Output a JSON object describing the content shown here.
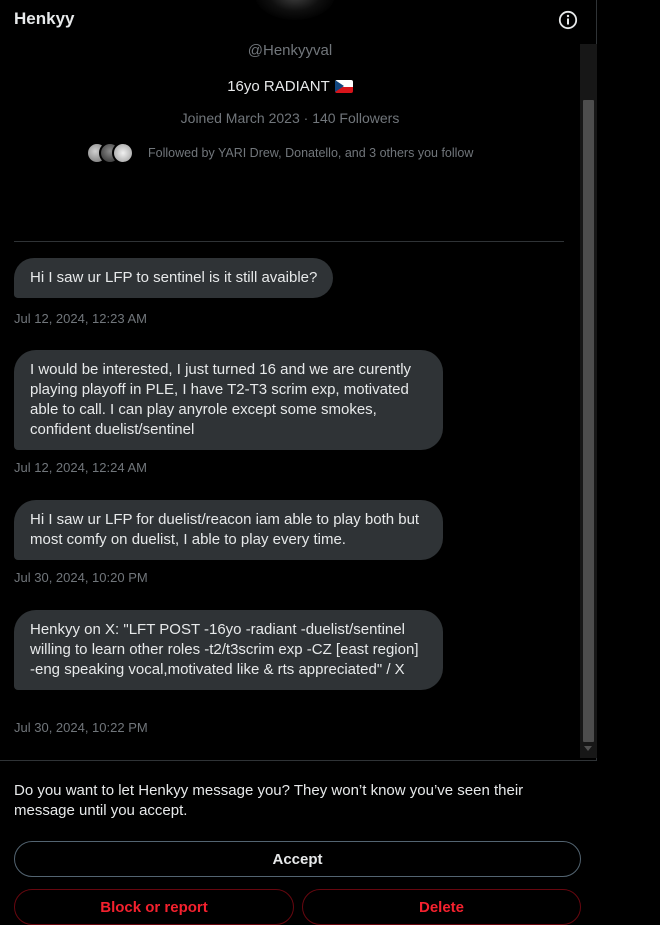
{
  "header": {
    "title": "Henkyy",
    "info_icon": "info-icon"
  },
  "profile": {
    "handle": "@Henkyyval",
    "bio": "16yo RADIANT",
    "bio_flag": "czech-flag",
    "joined": "Joined March 2023",
    "separator": "·",
    "followers": "140 Followers",
    "followed_by": "Followed by YARI Drew, Donatello, and 3 others you follow"
  },
  "messages": [
    {
      "text": "Hi I saw ur LFP to sentinel is it still avaible?",
      "time": "Jul 12, 2024, 12:23 AM"
    },
    {
      "text": "I would be interested, I just turned 16 and we are curently playing playoff in PLE, I have T2-T3 scrim exp, motivated able to call. I can play anyrole except some smokes, confident duelist/sentinel",
      "time": "Jul 12, 2024, 12:24 AM"
    },
    {
      "text": "Hi I saw ur LFP for duelist/reacon iam able to play both but most comfy on duelist, I able to play every time.",
      "time": "Jul 30, 2024, 10:20 PM"
    },
    {
      "text": "Henkyy on X: \"LFT POST -16yo -radiant -duelist/sentinel willing to learn other roles -t2/t3scrim exp -CZ [east region] -eng speaking vocal,motivated like & rts appreciated\" / X",
      "time": "Jul 30, 2024, 10:22 PM"
    }
  ],
  "request": {
    "prompt": "Do you want to let Henkyy message you? They won’t know you’ve seen their message until you accept.",
    "accept_label": "Accept",
    "block_label": "Block or report",
    "delete_label": "Delete"
  },
  "colors": {
    "background": "#000000",
    "bubble": "#2f3336",
    "text": "#e7e9ea",
    "muted": "#71767b",
    "danger": "#f4212e"
  }
}
